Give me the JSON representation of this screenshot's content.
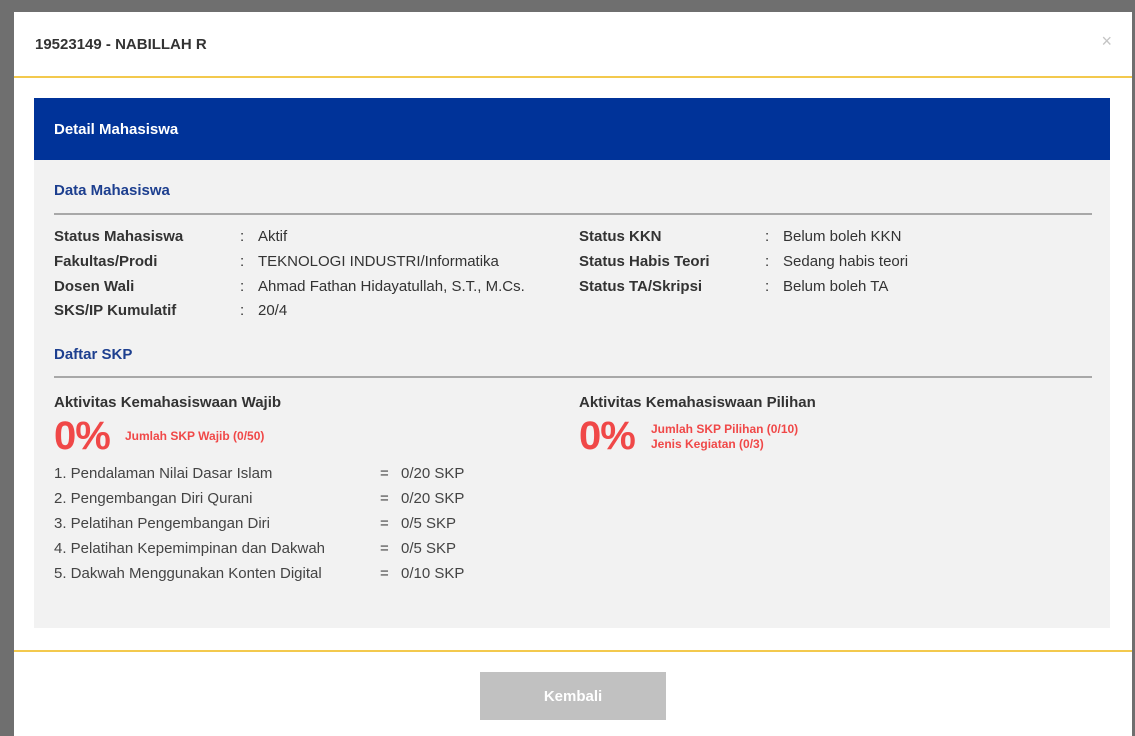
{
  "modal": {
    "title": "19523149 - NABILLAH R",
    "close_icon": "×"
  },
  "panel": {
    "header": "Detail Mahasiswa",
    "data_section_title": "Data Mahasiswa",
    "left_info": [
      {
        "label": "Status Mahasiswa",
        "colon": ":",
        "value": "Aktif"
      },
      {
        "label": "Fakultas/Prodi",
        "colon": ":",
        "value": "TEKNOLOGI INDUSTRI/Informatika"
      },
      {
        "label": "Dosen Wali",
        "colon": ":",
        "value": "Ahmad Fathan Hidayatullah, S.T., M.Cs."
      },
      {
        "label": "SKS/IP Kumulatif",
        "colon": ":",
        "value": "20/4"
      }
    ],
    "right_info": [
      {
        "label": "Status KKN",
        "colon": ":",
        "value": "Belum boleh KKN"
      },
      {
        "label": "Status Habis Teori",
        "colon": ":",
        "value": "Sedang habis teori"
      },
      {
        "label": "Status TA/Skripsi",
        "colon": ":",
        "value": "Belum boleh TA"
      }
    ],
    "skp_section_title": "Daftar SKP",
    "wajib": {
      "title": "Aktivitas Kemahasiswaan Wajib",
      "percent": "0%",
      "note": "Jumlah SKP Wajib (0/50)",
      "items": [
        {
          "name": "1. Pendalaman Nilai Dasar Islam",
          "eq": "=",
          "amount": "0/20 SKP"
        },
        {
          "name": "2. Pengembangan Diri Qurani",
          "eq": "=",
          "amount": "0/20 SKP"
        },
        {
          "name": "3. Pelatihan Pengembangan Diri",
          "eq": "=",
          "amount": "0/5 SKP"
        },
        {
          "name": "4. Pelatihan Kepemimpinan dan Dakwah",
          "eq": "=",
          "amount": "0/5 SKP"
        },
        {
          "name": "5. Dakwah Menggunakan Konten Digital",
          "eq": "=",
          "amount": "0/10 SKP"
        }
      ]
    },
    "pilihan": {
      "title": "Aktivitas Kemahasiswaan Pilihan",
      "percent": "0%",
      "note_1": "Jumlah SKP Pilihan (0/10)",
      "note_2": "Jenis Kegiatan (0/3)"
    }
  },
  "footer": {
    "back_label": "Kembali"
  },
  "colors": {
    "header_blue": "#003399",
    "accent_yellow": "#f3c94d",
    "percent_red": "#f04848",
    "section_blue": "#1d3f8f"
  }
}
